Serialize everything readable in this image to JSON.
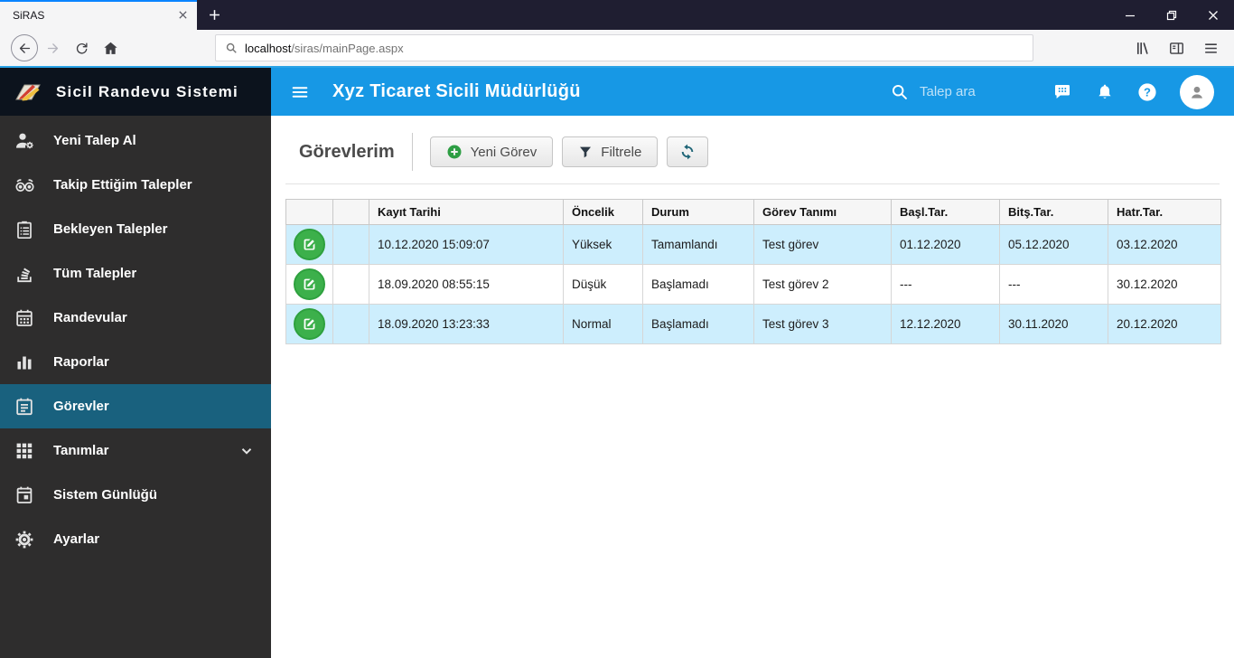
{
  "browser": {
    "tab_title": "SiRAS",
    "url_host": "localhost",
    "url_path": "/siras/mainPage.aspx"
  },
  "appbar": {
    "title": "Xyz Ticaret Sicili Müdürlüğü",
    "search_placeholder": "Talep ara"
  },
  "sidebar": {
    "brand": "Sicil Randevu Sistemi",
    "items": [
      {
        "name": "new-request",
        "label": "Yeni Talep Al",
        "icon": "person-add-icon",
        "active": false,
        "expandable": false
      },
      {
        "name": "followed-requests",
        "label": "Takip Ettiğim Talepler",
        "icon": "binoculars-icon",
        "active": false,
        "expandable": false
      },
      {
        "name": "pending-requests",
        "label": "Bekleyen Talepler",
        "icon": "clipboard-icon",
        "active": false,
        "expandable": false
      },
      {
        "name": "all-requests",
        "label": "Tüm Talepler",
        "icon": "stack-icon",
        "active": false,
        "expandable": false
      },
      {
        "name": "appointments",
        "label": "Randevular",
        "icon": "calendar-icon",
        "active": false,
        "expandable": false
      },
      {
        "name": "reports",
        "label": "Raporlar",
        "icon": "bar-chart-icon",
        "active": false,
        "expandable": false
      },
      {
        "name": "tasks",
        "label": "Görevler",
        "icon": "tasks-icon",
        "active": true,
        "expandable": false
      },
      {
        "name": "definitions",
        "label": "Tanımlar",
        "icon": "grid-icon",
        "active": false,
        "expandable": true
      },
      {
        "name": "system-log",
        "label": "Sistem Günlüğü",
        "icon": "calendar-log-icon",
        "active": false,
        "expandable": false
      },
      {
        "name": "settings",
        "label": "Ayarlar",
        "icon": "gear-icon",
        "active": false,
        "expandable": false
      }
    ]
  },
  "content": {
    "page_title": "Görevlerim",
    "buttons": {
      "new_task": "Yeni Görev",
      "filter": "Filtrele"
    }
  },
  "table": {
    "headers": [
      "",
      "",
      "Kayıt Tarihi",
      "Öncelik",
      "Durum",
      "Görev Tanımı",
      "Başl.Tar.",
      "Bitş.Tar.",
      "Hatr.Tar."
    ],
    "rows": [
      {
        "highlighted": true,
        "kayit_tarihi": "10.12.2020 15:09:07",
        "oncelik": "Yüksek",
        "durum": "Tamamlandı",
        "gorev_tanimi": "Test görev",
        "basl_tar": "01.12.2020",
        "bits_tar": "05.12.2020",
        "hatr_tar": "03.12.2020"
      },
      {
        "highlighted": false,
        "kayit_tarihi": "18.09.2020 08:55:15",
        "oncelik": "Düşük",
        "durum": "Başlamadı",
        "gorev_tanimi": "Test görev 2",
        "basl_tar": "---",
        "bits_tar": "---",
        "hatr_tar": "30.12.2020"
      },
      {
        "highlighted": true,
        "kayit_tarihi": "18.09.2020 13:23:33",
        "oncelik": "Normal",
        "durum": "Başlamadı",
        "gorev_tanimi": "Test görev 3",
        "basl_tar": "12.12.2020",
        "bits_tar": "30.11.2020",
        "hatr_tar": "20.12.2020"
      }
    ]
  },
  "colors": {
    "accent_blue": "#1798e5",
    "tab_strip_bg": "#1f1e31",
    "sidebar_bg": "#2e2d2d",
    "sidebar_header_bg": "#0c131d",
    "sidebar_active_bg": "#19617e",
    "row_highlight": "#cdeefd",
    "edit_green": "#3cb04b"
  }
}
